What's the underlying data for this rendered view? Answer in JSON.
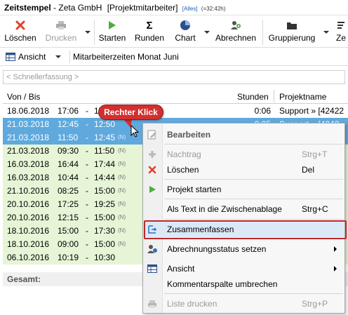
{
  "window": {
    "app": "Zeitstempel",
    "sep": " - ",
    "company": "Zeta GmbH",
    "role": "[Projektmitarbeiter]",
    "filter": "[Alles]",
    "total": "(=32:42h)"
  },
  "ribbon": {
    "buttons": [
      {
        "label": "Löschen",
        "icon": "delete-x-icon"
      },
      {
        "label": "Drucken",
        "icon": "printer-icon",
        "disabled": true
      },
      {
        "label": "Starten",
        "icon": "play-icon"
      },
      {
        "label": "Runden",
        "icon": "sigma-icon"
      },
      {
        "label": "Chart",
        "icon": "pie-chart-icon"
      },
      {
        "label": "Abrechnen",
        "icon": "bill-people-icon"
      },
      {
        "label": "Gruppierung",
        "icon": "folder-icon"
      },
      {
        "label": "Ze",
        "icon": "sort-icon"
      }
    ]
  },
  "viewbar": {
    "view_button": "Ansicht",
    "view_name": "Mitarbeiterzeiten Monat Juni"
  },
  "quick_entry": {
    "placeholder": "< Schnellerfassung >"
  },
  "table": {
    "headers": {
      "von_bis": "Von / Bis",
      "stunden": "Stunden",
      "projekt": "Projektname"
    },
    "rows": [
      {
        "date": "18.06.2018",
        "from": "17:06",
        "to": "17:12",
        "n": "",
        "stunden": "0:06",
        "proj": "Support » [42422",
        "style": "white"
      },
      {
        "date": "21.03.2018",
        "from": "12:45",
        "to": "12:50",
        "n": "",
        "stunden": "0:05",
        "proj": "Support » [4242",
        "style": "sel"
      },
      {
        "date": "21.03.2018",
        "from": "11:50",
        "to": "12:45",
        "n": "(N)",
        "stunden": "",
        "proj": "",
        "style": "sel"
      },
      {
        "date": "21.03.2018",
        "from": "09:30",
        "to": "11:50",
        "n": "(N)",
        "stunden": "",
        "proj": "",
        "style": "green"
      },
      {
        "date": "16.03.2018",
        "from": "16:44",
        "to": "17:44",
        "n": "(N)",
        "stunden": "",
        "proj": "",
        "style": "green"
      },
      {
        "date": "16.03.2018",
        "from": "10:44",
        "to": "14:44",
        "n": "(N)",
        "stunden": "",
        "proj": "",
        "style": "green"
      },
      {
        "date": "21.10.2016",
        "from": "08:25",
        "to": "15:00",
        "n": "(N)",
        "stunden": "",
        "proj": "",
        "style": "green"
      },
      {
        "date": "20.10.2016",
        "from": "17:25",
        "to": "19:25",
        "n": "(N)",
        "stunden": "",
        "proj": "",
        "style": "green"
      },
      {
        "date": "20.10.2016",
        "from": "12:15",
        "to": "15:00",
        "n": "(N)",
        "stunden": "",
        "proj": "",
        "style": "green"
      },
      {
        "date": "18.10.2016",
        "from": "15:00",
        "to": "17:30",
        "n": "(N)",
        "stunden": "",
        "proj": "",
        "style": "green"
      },
      {
        "date": "18.10.2016",
        "from": "09:00",
        "to": "15:00",
        "n": "(N)",
        "stunden": "",
        "proj": "",
        "style": "green"
      },
      {
        "date": "06.10.2016",
        "from": "10:19",
        "to": "10:30",
        "n": "",
        "stunden": "",
        "proj": "",
        "style": "green"
      }
    ],
    "total_label": "Gesamt:"
  },
  "callout": {
    "text": "Rechter Klick"
  },
  "context_menu": {
    "items": [
      {
        "label": "Bearbeiten",
        "key": "",
        "icon": "edit-icon",
        "state": "bold"
      },
      {
        "label": "Nachtrag",
        "key": "Strg+T",
        "icon": "plus-icon",
        "state": "dis"
      },
      {
        "label": "Löschen",
        "key": "Del",
        "icon": "delete-x-icon",
        "state": ""
      },
      {
        "label": "Projekt starten",
        "key": "",
        "icon": "play-icon",
        "state": ""
      },
      {
        "label": "Als Text in die Zwischenablage",
        "key": "Strg+C",
        "icon": "",
        "state": ""
      },
      {
        "label": "Zusammenfassen",
        "key": "",
        "icon": "merge-icon",
        "state": "hover"
      },
      {
        "label": "Abrechnungsstatus setzen",
        "key": "",
        "icon": "billing-status-icon",
        "state": "",
        "submenu": true
      },
      {
        "label": "Ansicht",
        "key": "",
        "icon": "table-view-icon",
        "state": "",
        "submenu": true
      },
      {
        "label": "Kommentarspalte umbrechen",
        "key": "",
        "icon": "",
        "state": ""
      },
      {
        "label": "Liste drucken",
        "key": "Strg+P",
        "icon": "printer-icon",
        "state": "dis"
      }
    ]
  },
  "colors": {
    "green_row": "#e6f5d6",
    "selected_row": "#5fa9dd",
    "callout": "#d32f2f",
    "highlight_border": "#c0272d"
  }
}
